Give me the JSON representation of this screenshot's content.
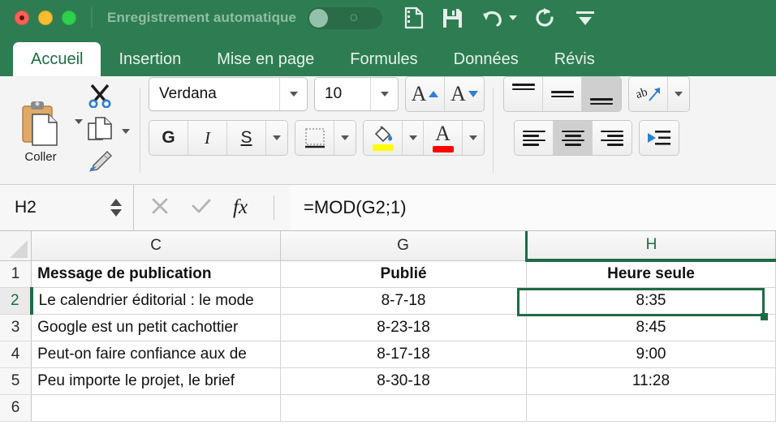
{
  "titlebar": {
    "autosave_label": "Enregistrement automatique",
    "toggle_state": "O",
    "icons": [
      "new-document-icon",
      "save-icon",
      "undo-icon",
      "redo-icon",
      "customize-toolbar-icon"
    ]
  },
  "tabs": [
    {
      "label": "Accueil",
      "active": true
    },
    {
      "label": "Insertion",
      "active": false
    },
    {
      "label": "Mise en page",
      "active": false
    },
    {
      "label": "Formules",
      "active": false
    },
    {
      "label": "Données",
      "active": false
    },
    {
      "label": "Révis",
      "active": false
    }
  ],
  "ribbon": {
    "paste_label": "Coller",
    "font_name": "Verdana",
    "font_size": "10",
    "bold_label": "G",
    "italic_label": "I",
    "underline_label": "S",
    "increase_font_label": "A",
    "decrease_font_label": "A",
    "highlight_color": "#ffff00",
    "font_color": "#ff0000",
    "wrap_text_label": "ab"
  },
  "formula_bar": {
    "name_box": "H2",
    "formula": "=MOD(G2;1)",
    "cancel_icon": "close-icon",
    "confirm_icon": "check-icon",
    "function_icon": "fx"
  },
  "grid": {
    "columns": [
      {
        "letter": "C",
        "selected": false
      },
      {
        "letter": "G",
        "selected": false
      },
      {
        "letter": "H",
        "selected": true
      }
    ],
    "rows": [
      {
        "number": "1",
        "active": false,
        "cells": [
          {
            "value": "Message de publication",
            "align": "left",
            "bold": true
          },
          {
            "value": "Publié",
            "align": "center",
            "bold": true
          },
          {
            "value": "Heure seule",
            "align": "center",
            "bold": true
          }
        ]
      },
      {
        "number": "2",
        "active": true,
        "cells": [
          {
            "value": "Le calendrier éditorial : le mode",
            "align": "left",
            "bold": false
          },
          {
            "value": "8-7-18",
            "align": "center",
            "bold": false
          },
          {
            "value": "8:35",
            "align": "center",
            "bold": false
          }
        ]
      },
      {
        "number": "3",
        "active": false,
        "cells": [
          {
            "value": "Google est un petit cachottier",
            "align": "left",
            "bold": false
          },
          {
            "value": "8-23-18",
            "align": "center",
            "bold": false
          },
          {
            "value": "8:45",
            "align": "center",
            "bold": false
          }
        ]
      },
      {
        "number": "4",
        "active": false,
        "cells": [
          {
            "value": "Peut-on faire confiance aux de",
            "align": "left",
            "bold": false
          },
          {
            "value": "8-17-18",
            "align": "center",
            "bold": false
          },
          {
            "value": "9:00",
            "align": "center",
            "bold": false
          }
        ]
      },
      {
        "number": "5",
        "active": false,
        "cells": [
          {
            "value": "Peu importe le projet, le brief",
            "align": "left",
            "bold": false
          },
          {
            "value": "8-30-18",
            "align": "center",
            "bold": false
          },
          {
            "value": "11:28",
            "align": "center",
            "bold": false
          }
        ]
      },
      {
        "number": "6",
        "active": false,
        "cells": [
          {
            "value": "",
            "align": "left",
            "bold": false
          },
          {
            "value": "",
            "align": "center",
            "bold": false
          },
          {
            "value": "",
            "align": "center",
            "bold": false
          }
        ]
      }
    ],
    "selected_cell": "H2"
  },
  "colors": {
    "brand_green": "#2e7d52",
    "selection_green": "#1f6b45",
    "ribbon_bg": "#f4f4f4"
  }
}
